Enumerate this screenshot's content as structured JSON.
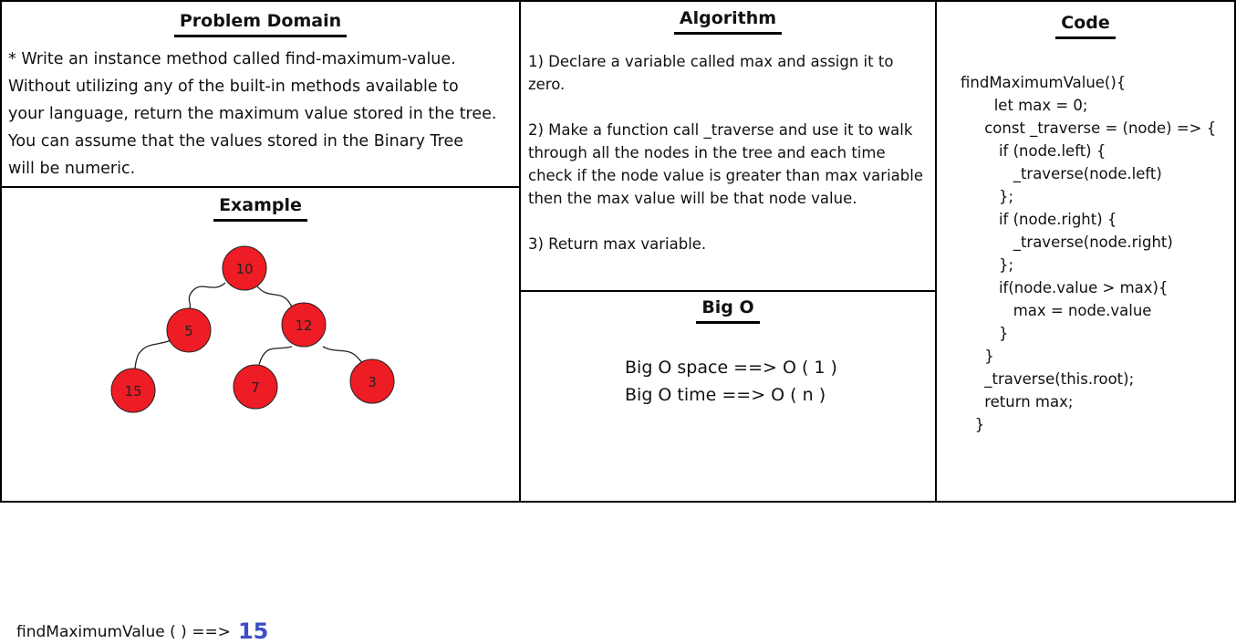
{
  "problem_domain": {
    "heading": "Problem Domain",
    "lines": [
      "* Write an instance method called find-maximum-value.",
      "Without utilizing any of the built-in methods available to",
      "your language, return the maximum value stored in the tree.",
      "You can assume that the values stored in the Binary Tree",
      "will be numeric."
    ]
  },
  "example": {
    "heading": "Example",
    "tree_nodes": [
      "10",
      "5",
      "12",
      "15",
      "7",
      "3"
    ],
    "call_text": "findMaximumValue ( ) ==>",
    "result": "15"
  },
  "algorithm": {
    "heading": "Algorithm",
    "steps": [
      "1) Declare a variable called max and assign it to zero.",
      "2) Make a function call _traverse and use it to walk through all the nodes in the tree and each time check if the node value is greater than max variable then the max value will be that node value.",
      "3) Return max variable."
    ]
  },
  "big_o": {
    "heading": "Big O",
    "space": "Big O space ==> O ( 1 )",
    "time": "Big O time ==>  O ( n )"
  },
  "code": {
    "heading": "Code",
    "text": "findMaximumValue(){\n       let max = 0;\n     const _traverse = (node) => {\n        if (node.left) {\n           _traverse(node.left)\n        };\n        if (node.right) {\n           _traverse(node.right)\n        };\n        if(node.value > max){\n           max = node.value\n        }\n     }\n     _traverse(this.root);\n     return max;\n   }"
  },
  "colors": {
    "node_fill": "#ee1c24",
    "result_text": "#3b4ec7"
  }
}
